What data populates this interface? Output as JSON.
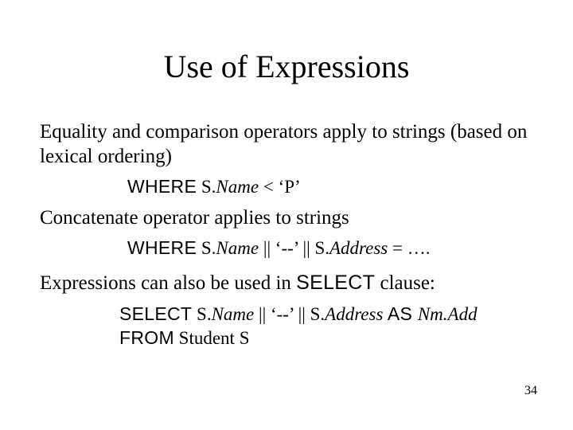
{
  "title": "Use of Expressions",
  "para1": "Equality and comparison operators apply to strings (based on lexical ordering)",
  "code1": {
    "kw_where": "WHERE",
    "expr_pre": " S.",
    "expr_name": "Name",
    "expr_post": " < ‘P’"
  },
  "para2": "Concatenate operator applies to strings",
  "code2": {
    "kw_where": "WHERE",
    "sdot1": " S.",
    "name": "Name",
    "mid": " || ‘--’ || S.",
    "address": "Address",
    "tail": " = …."
  },
  "para3": {
    "pre": "Expressions can also be used in ",
    "select": "SELECT",
    "post": " clause:"
  },
  "code3": {
    "kw_select": "SELECT",
    "sdot1": "  S.",
    "name": "Name",
    "mid": " || ‘--’ || S.",
    "address": "Address",
    "kw_as": " AS ",
    "alias": "Nm.Add",
    "kw_from": "FROM",
    "from_rest": "  Student S"
  },
  "page_number": "34"
}
